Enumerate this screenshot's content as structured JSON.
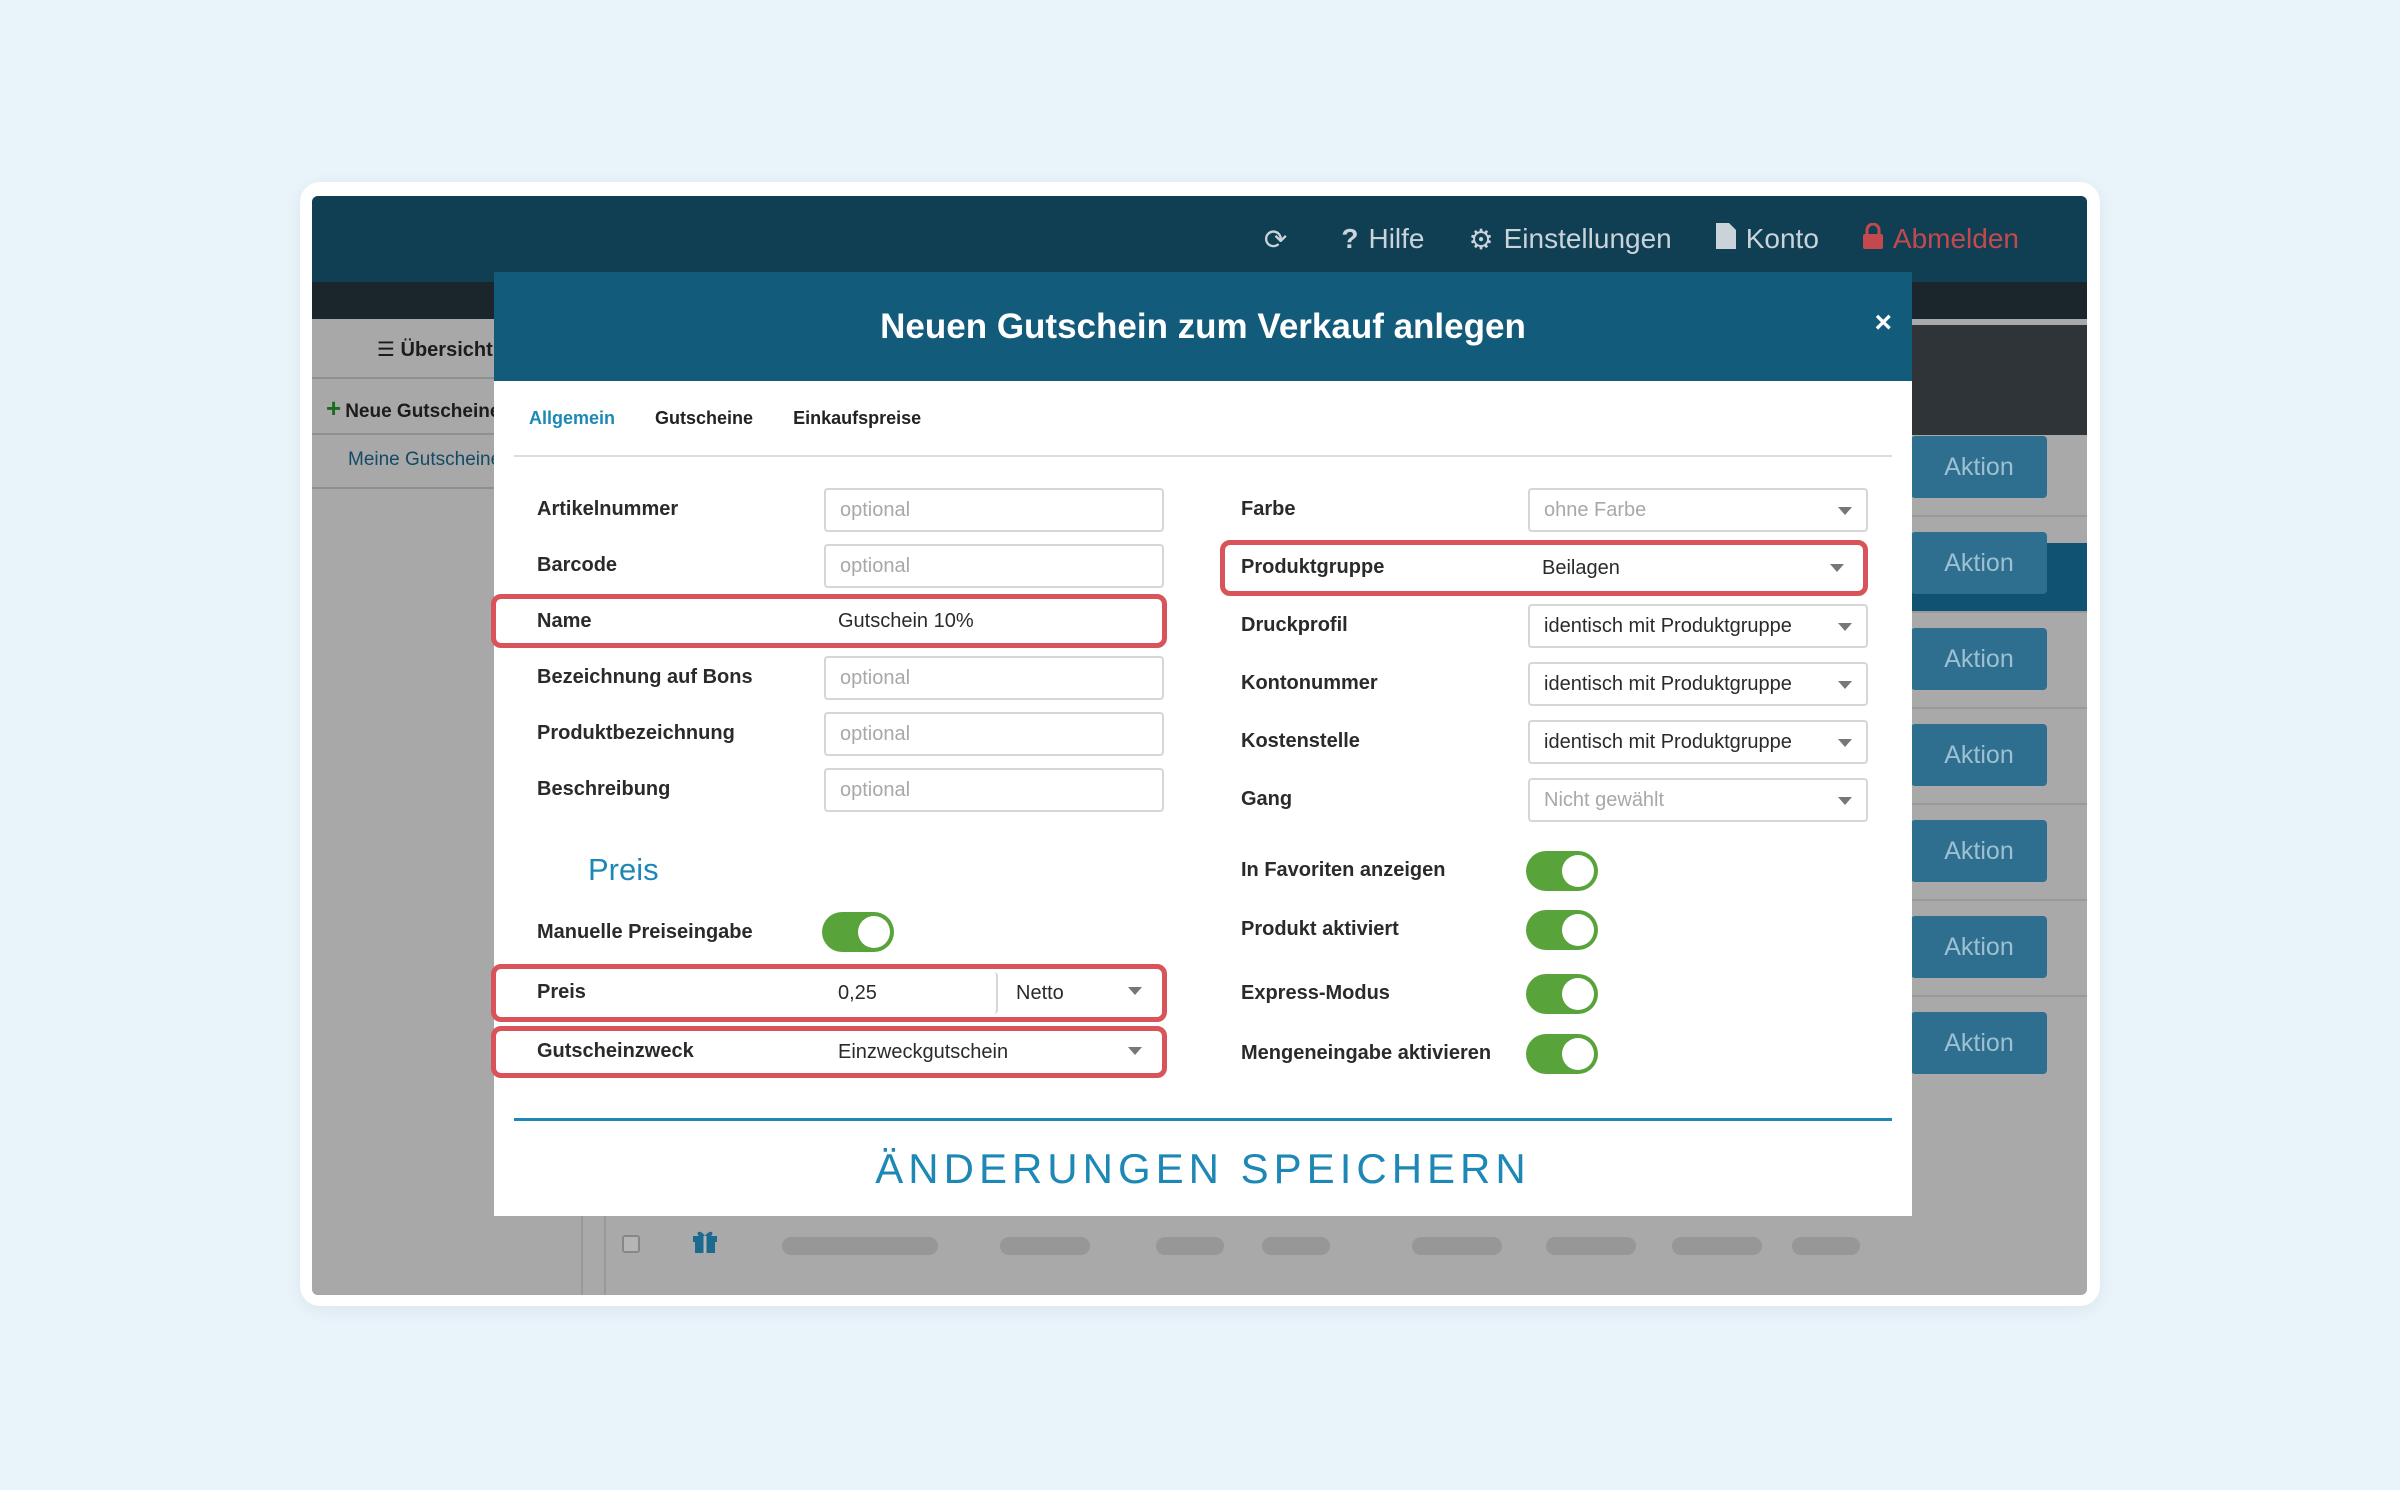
{
  "topbar": {
    "hilfe": "Hilfe",
    "einstellungen": "Einstellungen",
    "konto": "Konto",
    "abmelden": "Abmelden"
  },
  "sidebar": {
    "header": "Übersicht",
    "new_item": "Neue Gutscheine",
    "link": "Meine Gutscheine"
  },
  "background": {
    "action_label": "Aktion",
    "action_count": 7
  },
  "modal": {
    "title": "Neuen Gutschein zum Verkauf anlegen",
    "close": "×",
    "tabs": [
      "Allgemein",
      "Gutscheine",
      "Einkaufspreise"
    ],
    "left": {
      "artikelnummer": {
        "label": "Artikelnummer",
        "placeholder": "optional"
      },
      "barcode": {
        "label": "Barcode",
        "placeholder": "optional"
      },
      "name": {
        "label": "Name",
        "value": "Gutschein 10%"
      },
      "bezeichnung_bons": {
        "label": "Bezeichnung auf Bons",
        "placeholder": "optional"
      },
      "produktbezeichnung": {
        "label": "Produktbezeichnung",
        "placeholder": "optional"
      },
      "beschreibung": {
        "label": "Beschreibung",
        "placeholder": "optional"
      },
      "preis_section": "Preis",
      "manuelle_preiseingabe": {
        "label": "Manuelle Preiseingabe",
        "on": true
      },
      "preis": {
        "label": "Preis",
        "value": "0,25",
        "type": "Netto"
      },
      "gutscheinzweck": {
        "label": "Gutscheinzweck",
        "value": "Einzweckgutschein"
      }
    },
    "right": {
      "farbe": {
        "label": "Farbe",
        "value": "ohne Farbe"
      },
      "produktgruppe": {
        "label": "Produktgruppe",
        "value": "Beilagen"
      },
      "druckprofil": {
        "label": "Druckprofil",
        "value": "identisch mit Produktgruppe"
      },
      "kontonummer": {
        "label": "Kontonummer",
        "value": "identisch mit Produktgruppe"
      },
      "kostenstelle": {
        "label": "Kostenstelle",
        "value": "identisch mit Produktgruppe"
      },
      "gang": {
        "label": "Gang",
        "value": "Nicht gewählt"
      },
      "favoriten": {
        "label": "In Favoriten anzeigen",
        "on": true
      },
      "aktiviert": {
        "label": "Produkt aktiviert",
        "on": true
      },
      "express": {
        "label": "Express-Modus",
        "on": true
      },
      "mengeneingabe": {
        "label": "Mengeneingabe aktivieren",
        "on": true
      }
    },
    "save": "ÄNDERUNGEN SPEICHERN"
  },
  "colors": {
    "header": "#125b7a",
    "accent": "#1d88b5",
    "highlight": "#d9545a",
    "toggle_on": "#58a43a",
    "logout": "#c24a4f"
  }
}
